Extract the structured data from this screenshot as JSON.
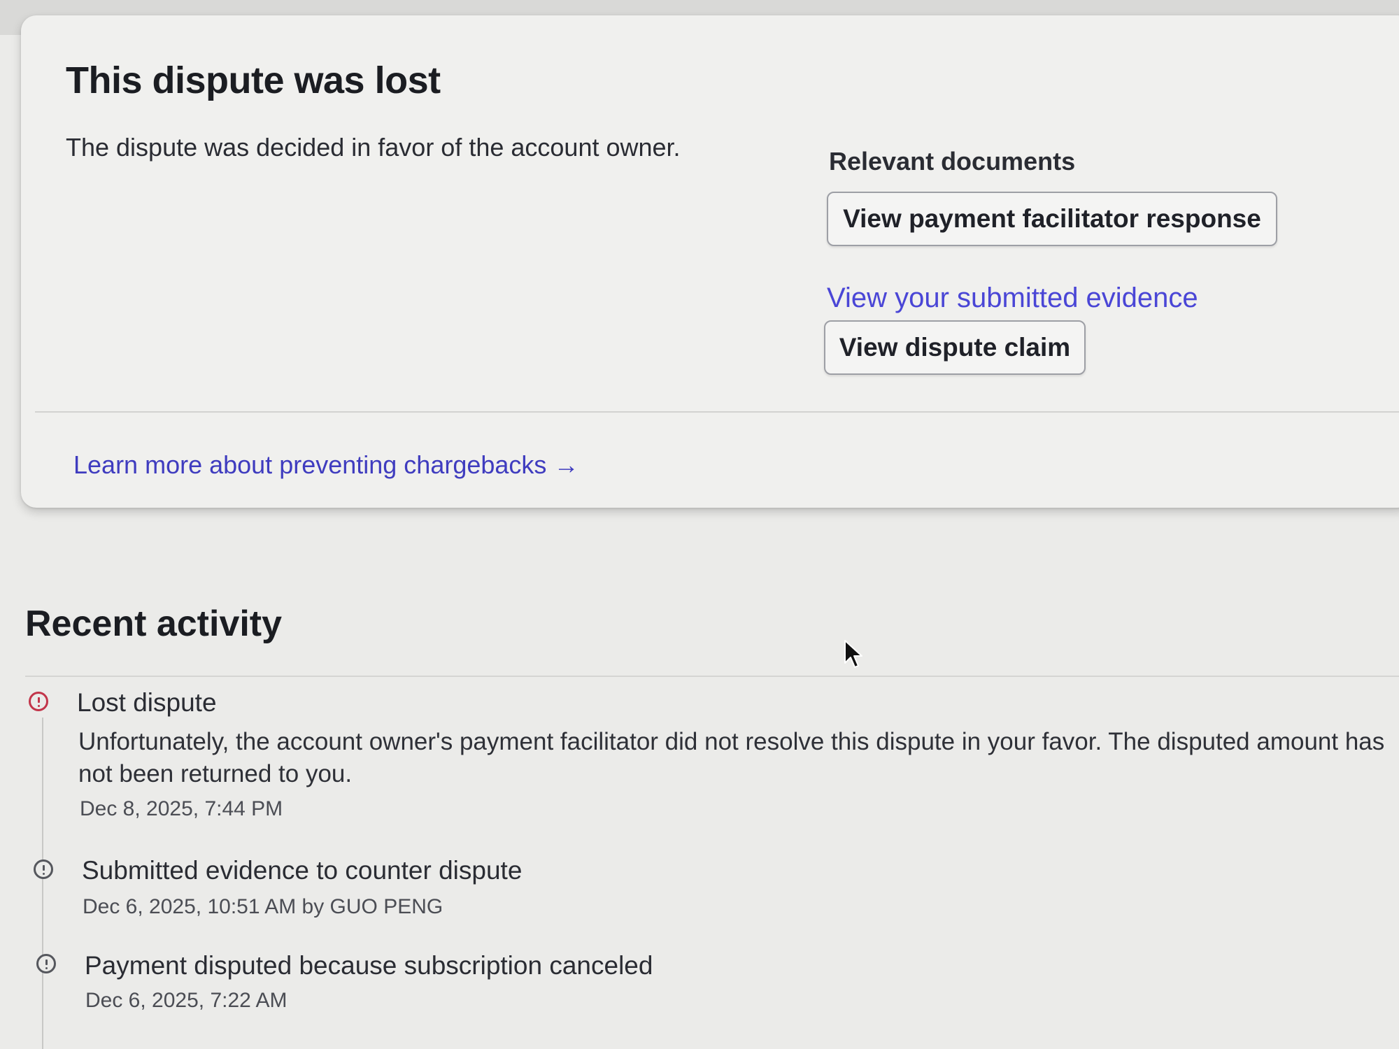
{
  "dispute": {
    "title": "This dispute was lost",
    "subtitle": "The dispute was decided in favor of the account owner.",
    "documents_heading": "Relevant documents",
    "facilitator_button_label": "View payment facilitator response",
    "evidence_link_label": "View your submitted evidence",
    "claim_button_label": "View dispute claim",
    "learn_more_label": "Learn more about preventing chargebacks",
    "learn_more_icon": "arrow-right-icon",
    "link_color": "#4a46d6"
  },
  "activity": {
    "heading": "Recent activity",
    "events": [
      {
        "title": "Lost dispute",
        "description": "Unfortunately, the account owner's payment facilitator did not resolve this dispute in your favor. The disputed amount has not been returned to you.",
        "time": "Dec 8, 2025, 7:44 PM",
        "icon": "alert-circle-icon",
        "icon_color": "#c2354a"
      },
      {
        "title": "Submitted evidence to counter dispute",
        "time": "Dec 6, 2025, 10:51 AM by GUO PENG",
        "icon": "info-circle-icon",
        "icon_color": "#55575d"
      },
      {
        "title": "Payment disputed because subscription canceled",
        "time": "Dec 6, 2025, 7:22 AM",
        "icon": "info-circle-icon",
        "icon_color": "#55575d"
      }
    ]
  }
}
